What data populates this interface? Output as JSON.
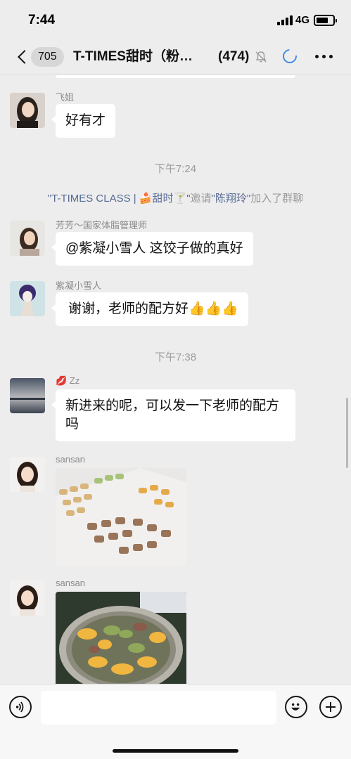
{
  "status": {
    "time": "7:44",
    "network": "4G"
  },
  "nav": {
    "unread_count": "705",
    "title": "T-TIMES甜时（粉…",
    "member_count": "(474)"
  },
  "messages": [
    {
      "sender": "飞姐",
      "text": "好有才"
    },
    {
      "sender": "芳芳～国家体脂管理师",
      "text": "@紫凝小雪人 这饺子做的真好"
    },
    {
      "sender": "紫凝小雪人",
      "text": "谢谢，老师的配方好👍👍👍"
    },
    {
      "sender": "💋 Zz",
      "text": "新进来的呢，可以发一下老师的配方吗"
    },
    {
      "sender": "sansan",
      "image": "dumplings-tray-photo"
    },
    {
      "sender": "sansan",
      "image": "hotpot-photo"
    }
  ],
  "timestamps": [
    "下午7:24",
    "下午7:38"
  ],
  "system_notice": {
    "group": "\"T-TIMES CLASS | 🍰甜时🍸\"",
    "verb": "邀请",
    "invitee": "\"陈翔玲\"",
    "suffix": "加入了群聊"
  },
  "input": {
    "placeholder": ""
  },
  "colors": {
    "background": "#ededed",
    "bubble": "#ffffff",
    "link": "#576b95",
    "accent": "#3f8ae6"
  },
  "icons": [
    "back-chevron-icon",
    "mute-bell-icon",
    "sync-icon",
    "more-icon",
    "voice-icon",
    "emoji-icon",
    "plus-icon"
  ]
}
